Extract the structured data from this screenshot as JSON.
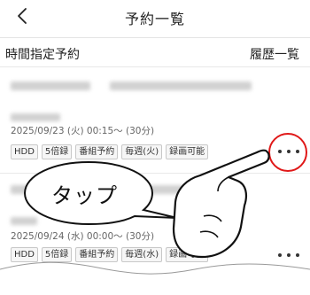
{
  "header": {
    "title": "予約一覧"
  },
  "section": {
    "left": "時間指定予約",
    "right": "履歴一覧"
  },
  "items": [
    {
      "date": "2025/09/23 (火) 00:15～ (30分)",
      "tags": [
        "HDD",
        "5倍録",
        "番組予約",
        "毎週(火)",
        "録画可能"
      ]
    },
    {
      "date": "2025/09/24 (水) 00:00～ (30分)",
      "tags": [
        "HDD",
        "5倍録",
        "番組予約",
        "毎週(水)",
        "録画可能"
      ]
    }
  ],
  "annotation": {
    "bubble_text": "タップ"
  },
  "colors": {
    "highlight": "#e01818",
    "text": "#222222",
    "muted": "#666666"
  },
  "icons": {
    "back": "chevron-left-icon",
    "more": "more-horizontal-icon",
    "hand": "pointing-hand-icon"
  }
}
